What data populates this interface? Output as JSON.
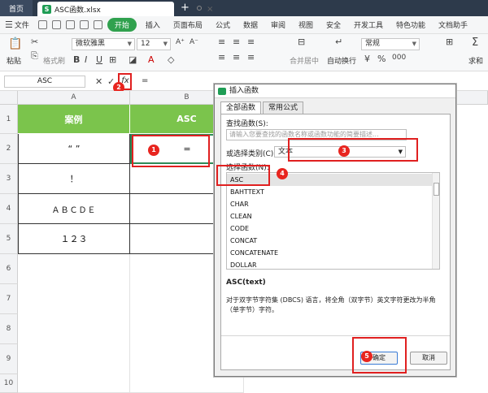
{
  "tabs": {
    "home": "首页",
    "file": "ASC函数.xlsx",
    "plus": "+",
    "file_icon": "S"
  },
  "menu": {
    "file": "文件",
    "items": [
      "开始",
      "插入",
      "页面布局",
      "公式",
      "数据",
      "审阅",
      "视图",
      "安全",
      "开发工具",
      "特色功能",
      "文档助手"
    ]
  },
  "ribbon": {
    "paste": "粘贴",
    "format_painter": "格式刷",
    "font_name": "微软雅黑",
    "font_size": "12",
    "merge": "合并居中",
    "wrap": "自动换行",
    "number_format": "常规",
    "sum": "求和"
  },
  "formula_bar": {
    "name_box": "ASC",
    "fx": "fx",
    "content": "="
  },
  "sheet": {
    "columns": [
      "A",
      "B"
    ],
    "rows": [
      "1",
      "2",
      "3",
      "4",
      "5",
      "6",
      "7",
      "8",
      "9",
      "10"
    ],
    "header": {
      "a": "案例",
      "b": "ASC"
    },
    "cells_a": [
      "“  ”",
      "！",
      "ＡＢＣＤＥ",
      "１２３"
    ],
    "cell_b2": "="
  },
  "dialog": {
    "title": "插入函数",
    "tabs": [
      "全部函数",
      "常用公式"
    ],
    "search_label": "查找函数(S):",
    "search_placeholder": "请输入您要查找的函数名称或函数功能的简要描述...",
    "category_label": "或选择类别(C):",
    "category_value": "文本",
    "select_label": "选择函数(N):",
    "functions": [
      "ASC",
      "BAHTTEXT",
      "CHAR",
      "CLEAN",
      "CODE",
      "CONCAT",
      "CONCATENATE",
      "DOLLAR"
    ],
    "signature": "ASC(text)",
    "description": "对于双字节字符集 (DBCS) 语言，将全角（双字节）英文字符更改为半角（单字节）字符。",
    "ok": "确定",
    "cancel": "取消"
  },
  "badges": [
    "1",
    "2",
    "3",
    "4",
    "5"
  ],
  "highlight_color": "#e02020",
  "header_fill": "#7bc44c"
}
